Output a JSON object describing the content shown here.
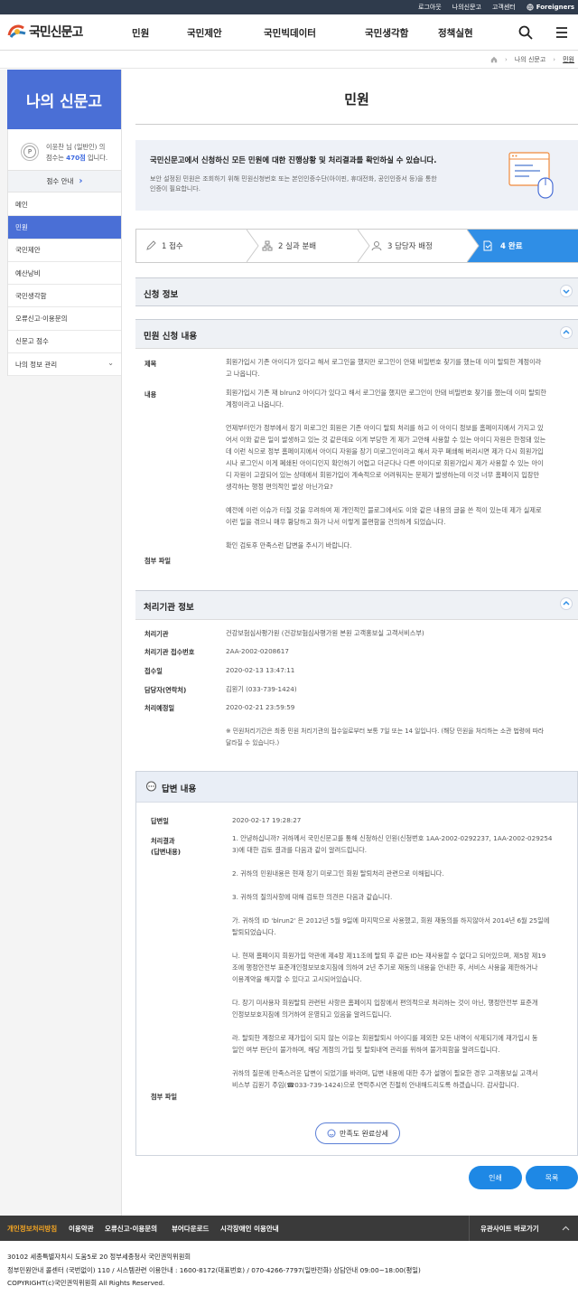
{
  "topbar": {
    "logout": "로그아웃",
    "my": "나의신문고",
    "cs": "고객센터",
    "foreigners": "Foreigners"
  },
  "logo": {
    "text": "국민신문고"
  },
  "gnb": [
    "민원",
    "국민제안",
    "국민빅데이터",
    "국민생각함",
    "정책실현"
  ],
  "breadcrumb": {
    "home": "home",
    "c1": "나의 신문고",
    "c2": "민원"
  },
  "side": {
    "title": "나의 신문고",
    "user_line1": "이윤찬 님 (일반인) 의",
    "user_line2a": "점수는 ",
    "user_points": "470점",
    "user_line2b": " 입니다.",
    "score_guide": "점수 안내",
    "menu": [
      "메인",
      "민원",
      "국민제안",
      "예산낭비",
      "국민생각함",
      "오류신고·이용문의",
      "신문고 점수",
      "나의 정보 관리"
    ]
  },
  "page_title": "민원",
  "notice": {
    "title": "국민신문고에서 신청하신 모든 민원에 대한 진행상황 및 처리결과를 확인하실 수 있습니다.",
    "body1": "보안 설정된 민원은 조회하기 위해 민원신청번호 또는 본인인증수단(아이핀, 휴대전화, 공인인증서 등)을 통한",
    "body2": "인증이 필요합니다."
  },
  "steps": [
    {
      "n": "1 접수",
      "icon": "pencil-icon"
    },
    {
      "n": "2 실과 분배",
      "icon": "org-chart-icon"
    },
    {
      "n": "3 담당자 배정",
      "icon": "person-icon"
    },
    {
      "n": "4 완료",
      "icon": "document-icon"
    }
  ],
  "sec_apply": "신청 정보",
  "sec_content": "민원 신청 내용",
  "apply": {
    "title_label": "제목",
    "title_lines": [
      "회원가입시 기존 아이디가 있다고 해서 로그인을 했지만 로그인이 안돼 비밀번호 찾기를 했는데 이미 탈퇴한 계정이라",
      "고 나옵니다."
    ],
    "content_label": "내용",
    "content_lines": [
      "회원가입시 기존 재 blrun2 아이디가 있다고 해서 로그인을 했지만 로그인이 안돼 비밀번호 찾기를 했는데 이미 탈퇴한",
      "계정이라고 나옵니다.",
      "",
      "언제부터인가 정부에서 장기 미로그인 회원은 기존 아이디 탈퇴 처리를 하고 이 아이디 정보를 홈페이지에서 가지고 있",
      "어서 이와 같은 일이 발생하고 있는 것 같은데요 이게 부당한 게 제가 고안해 사용할 수 있는 아이디 자원은 한정돼 있는",
      "데 이런 식으로 정부 홈페이지에서 아이디 자원을 장기 미로그인이라고 해서 자꾸 폐쇄해 버리시면 제가 다시 회원가입",
      "시나 로그인시 이게 폐쇄된 아이디인지 확인하기 어렵고 더군다나 다른 아이디로 회원가입시 제가 사용할 수 있는 아이",
      "디 자원이 고갈되어 있는 상태에서 회원가입이 계속적으로 어려워지는 문제가 발생하는데 이것 너무 홈페이지 입장만",
      "생각하는 행정 편의적인 발상 아닌가요?",
      "",
      "예전에 이런 이슈가 터질 것을 우려하여 제 개인적인 블로그에서도 이와 같은 내용의 글을 쓴 적이 있는데 제가 실제로",
      "이런 일을 겪으니 매우 황당하고 화가 나서 이렇게 불편함을 건의하게 되었습니다.",
      "",
      "확인  검토후 만족스런 답변을 주시기 바랍니다."
    ],
    "file_label": "첨부 파일"
  },
  "sec_org": "처리기관 정보",
  "org": [
    {
      "k": "처리기관",
      "v": "건강보험심사평가원 (건강보험심사평가원 본원 고객홍보실 고객서비스부)"
    },
    {
      "k": "처리기관 접수번호",
      "v": "2AA-2002-0208617"
    },
    {
      "k": "접수일",
      "v": "2020-02-13 13:47:11"
    },
    {
      "k": "담당자(연락처)",
      "v": "김원기 (033-739-1424)"
    },
    {
      "k": "처리예정일",
      "v": "2020-02-21 23:59:59"
    }
  ],
  "org_note": [
    "※ 민원처리기간은 최종 민원 처리기관의 접수일로부터 보통 7일 또는 14 일입니다. (해당 민원을 처리하는 소관 법령에 따라",
    "달라질 수 있습니다.)"
  ],
  "answer": {
    "title": "답변 내용",
    "date_label": "답변일",
    "date": "2020-02-17 19:28:27",
    "result_label1": "처리결과",
    "result_label2": "(답변내용)",
    "lines": [
      "1. 안녕하십니까? 귀하께서 국민신문고를 통해 신청하신 민원(신청번호 1AA-2002-0292237, 1AA-2002-029254",
      "3)에 대한 검토 결과를 다음과 같이 알려드립니다.",
      "",
      "2. 귀하의 민원내용은 현재 장기 미로그인 회원 탈퇴처리 관련으로 이해됩니다.",
      "",
      "3. 귀하의 질의사항에 대해 검토한 의견은 다음과 같습니다.",
      "",
      "가. 귀하의 ID 'blrun2' 은 2012년 5월 9일에 마지막으로 사용했고, 회원 재동의를 하지않아서 2014년 6월 25일에",
      "탈퇴되었습니다.",
      "",
      "나. 현재 홈페이지 회원가입 약관에 제4장 제11조에 탈퇴 후 같은 ID는 재사용할 수 없다고 되어있으며, 제5장 제19",
      "조에 행정안전부 표준개인정보보호지침에 의하여 2년 주기로 재동의 내용을 안내한 후, 서비스 사용을 제한하거나",
      "이용계약을 해지할 수 있다고 고시되어있습니다.",
      "",
      "다. 장기 미사용자 회원탈퇴 관련된 사항은 홈페이지 입장에서 편의적으로 처리하는 것이 아닌, 행정안전부 표준개",
      "인정보보호지침에 의거하여 운영되고 있음을 알려드립니다.",
      "",
      "라. 탈퇴한 계정으로 재가입이 되지 않는 이유는 회원탈퇴시 아이디를 제외한 모든 내역이 삭제되기에 재가입시 동",
      "일인 여부 판단이 불가하며, 해당 계정의 가입 및 탈퇴내역 관리를 위하여 불가피함을 알려드립니다.",
      "",
      "귀하의 질문에 만족스러운 답변이 되었기를 바라며, 답변 내용에 대한 추가 설명이 필요한 경우 고객홍보실 고객서",
      "비스부 김원기 주임(☎033-739-1424)으로 연락주시면 친절히 안내해드리도록 하겠습니다. 감사합니다."
    ],
    "file_label": "첨부 파일",
    "satisfaction": "만족도 완료상세"
  },
  "btn_print": "인쇄",
  "btn_list": "목록",
  "footer": {
    "links": [
      "개인정보처리방침",
      "이용약관",
      "오류신고·이용문의",
      "뷰어다운로드",
      "시각장애인 이용안내"
    ],
    "related": "유관사이트 바로가기",
    "addr1": "30102 세종특별자치시 도움5로 20 정부세종청사 국민권익위원회",
    "addr2": "정부민원안내 콜센터 (국번없이) 110 / 시스템관련 이용안내 : 1600-8172(대표번호) / 070-4266-7797(일반전화) 상담안내 09:00~18:00(평일)",
    "copy": "COPYRIGHT(c)국민권익위원회 All Rights Reserved."
  },
  "colors": {
    "primary": "#4a6fd6",
    "step_active": "#2f8ee6",
    "button": "#1e88e5",
    "topbar": "#2f3b4c",
    "footer": "#3a3a3a"
  }
}
